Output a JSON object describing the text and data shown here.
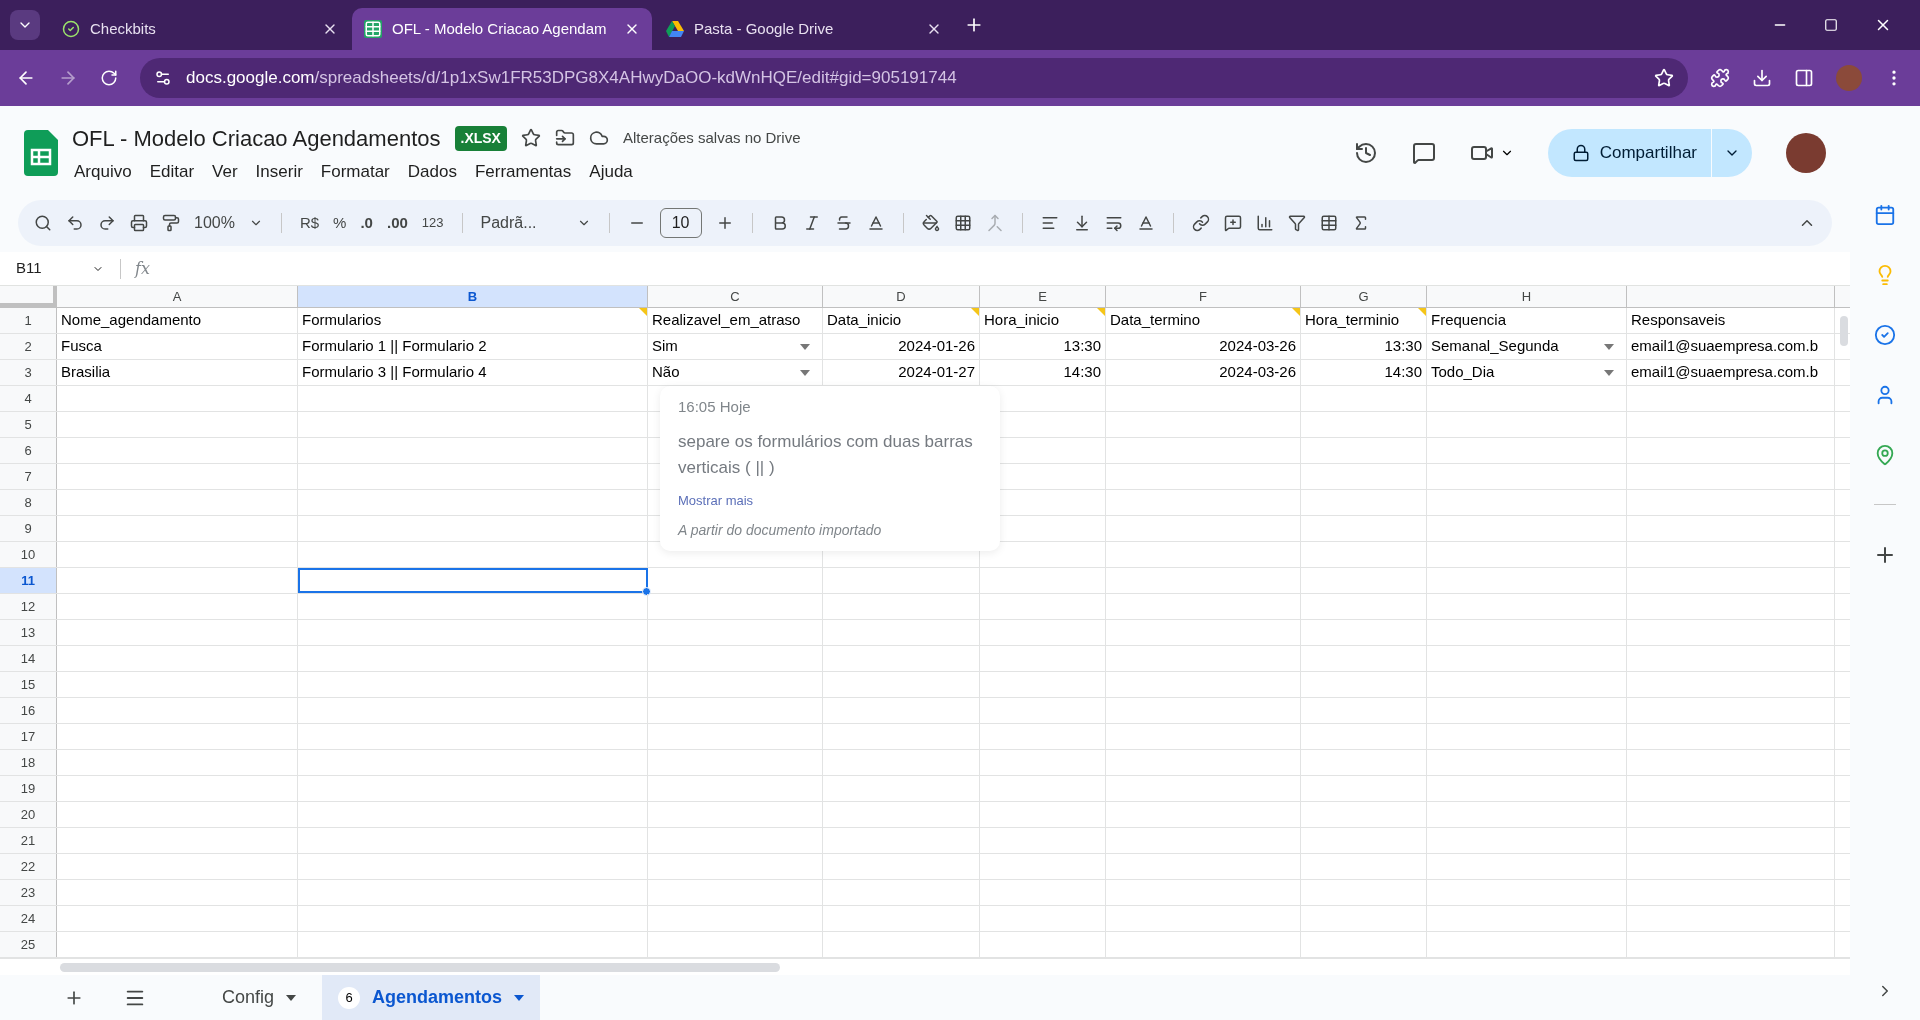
{
  "browser": {
    "tabs": [
      {
        "title": "Checkbits",
        "selected": false
      },
      {
        "title": "OFL - Modelo Criacao Agendam",
        "selected": true
      },
      {
        "title": "Pasta - Google Drive",
        "selected": false
      }
    ],
    "address": {
      "host": "docs.google.com",
      "path": "/spreadsheets/d/1p1xSw1FR53DPG8X4AHwyDaOO-kdWnHQE/edit#gid=905191744"
    }
  },
  "document": {
    "title": "OFL - Modelo Criacao Agendamentos",
    "badge": ".XLSX",
    "save_status": "Alterações salvas no Drive",
    "menu": [
      "Arquivo",
      "Editar",
      "Ver",
      "Inserir",
      "Formatar",
      "Dados",
      "Ferramentas",
      "Ajuda"
    ],
    "share": "Compartilhar"
  },
  "toolbar": {
    "zoom": "100%",
    "currency": "R$",
    "percent": "%",
    "decrease_decimal": ".0",
    "increase_decimal": ".00",
    "number_format": "123",
    "font": "Padrã...",
    "font_size": "10"
  },
  "formula_bar": {
    "name_box": "B11",
    "fx": "fx"
  },
  "columns": [
    {
      "label": "A",
      "selected": false
    },
    {
      "label": "B",
      "selected": true
    },
    {
      "label": "C",
      "selected": false
    },
    {
      "label": "D",
      "selected": false
    },
    {
      "label": "E",
      "selected": false
    },
    {
      "label": "F",
      "selected": false
    },
    {
      "label": "G",
      "selected": false
    },
    {
      "label": "H",
      "selected": false
    },
    {
      "selected": false
    }
  ],
  "rows": [
    {
      "number": "1",
      "selected": false,
      "cells": [
        {
          "kind": "text",
          "value": "Nome_agendamento",
          "note": false
        },
        {
          "kind": "text",
          "value": "Formularios",
          "note": true
        },
        {
          "kind": "text",
          "value": "Realizavel_em_atraso",
          "note": false
        },
        {
          "kind": "text",
          "value": "Data_inicio",
          "note": true
        },
        {
          "kind": "text",
          "value": "Hora_inicio",
          "note": true
        },
        {
          "kind": "text",
          "value": "Data_termino",
          "note": true
        },
        {
          "kind": "text",
          "value": "Hora_terminio",
          "note": true
        },
        {
          "kind": "text",
          "value": "Frequencia",
          "note": false
        },
        {
          "kind": "text",
          "value": "Responsaveis",
          "note": false
        }
      ]
    },
    {
      "number": "2",
      "selected": false,
      "cells": [
        {
          "kind": "text",
          "value": "Fusca",
          "note": false
        },
        {
          "kind": "text",
          "value": "Formulario 1 || Formulario 2",
          "note": false
        },
        {
          "kind": "dropdown",
          "value": "Sim",
          "note": false
        },
        {
          "kind": "number",
          "value": "2024-01-26",
          "note": false
        },
        {
          "kind": "number",
          "value": "13:30",
          "note": false
        },
        {
          "kind": "number",
          "value": "2024-03-26",
          "note": false
        },
        {
          "kind": "number",
          "value": "13:30",
          "note": false
        },
        {
          "kind": "dropdown",
          "value": "Semanal_Segunda",
          "note": false
        },
        {
          "kind": "text",
          "value": "email1@suaempresa.com.b",
          "note": false
        }
      ]
    },
    {
      "number": "3",
      "selected": false,
      "cells": [
        {
          "kind": "text",
          "value": "Brasilia",
          "note": false
        },
        {
          "kind": "text",
          "value": "Formulario 3 || Formulario 4",
          "note": false
        },
        {
          "kind": "dropdown",
          "value": "Não",
          "note": false
        },
        {
          "kind": "number",
          "value": "2024-01-27",
          "note": false
        },
        {
          "kind": "number",
          "value": "14:30",
          "note": false
        },
        {
          "kind": "number",
          "value": "2024-03-26",
          "note": false
        },
        {
          "kind": "number",
          "value": "14:30",
          "note": false
        },
        {
          "kind": "dropdown",
          "value": "Todo_Dia",
          "note": false
        },
        {
          "kind": "text",
          "value": "email1@suaempresa.com.b",
          "note": false
        }
      ]
    },
    {
      "number": "4",
      "selected": false
    },
    {
      "number": "5",
      "selected": false
    },
    {
      "number": "6",
      "selected": false
    },
    {
      "number": "7",
      "selected": false
    },
    {
      "number": "8",
      "selected": false
    },
    {
      "number": "9",
      "selected": false
    },
    {
      "number": "10",
      "selected": false
    },
    {
      "number": "11",
      "selected": true
    },
    {
      "number": "12",
      "selected": false
    },
    {
      "number": "13",
      "selected": false
    },
    {
      "number": "14",
      "selected": false
    },
    {
      "number": "15",
      "selected": false
    },
    {
      "number": "16",
      "selected": false
    },
    {
      "number": "17",
      "selected": false
    },
    {
      "number": "18",
      "selected": false
    },
    {
      "number": "19",
      "selected": false
    },
    {
      "number": "20",
      "selected": false
    },
    {
      "number": "21",
      "selected": false
    },
    {
      "number": "22",
      "selected": false
    },
    {
      "number": "23",
      "selected": false
    },
    {
      "number": "24",
      "selected": false
    },
    {
      "number": "25",
      "selected": false
    }
  ],
  "comment_popup": {
    "time": "16:05 Hoje",
    "text": "separe os formulários com duas barras verticais ( || )",
    "more": "Mostrar mais",
    "source": "A partir do documento importado"
  },
  "sheet_tabs": [
    {
      "label": "Config",
      "selected": false
    },
    {
      "label": "Agendamentos",
      "selected": true,
      "badge": "6"
    }
  ]
}
